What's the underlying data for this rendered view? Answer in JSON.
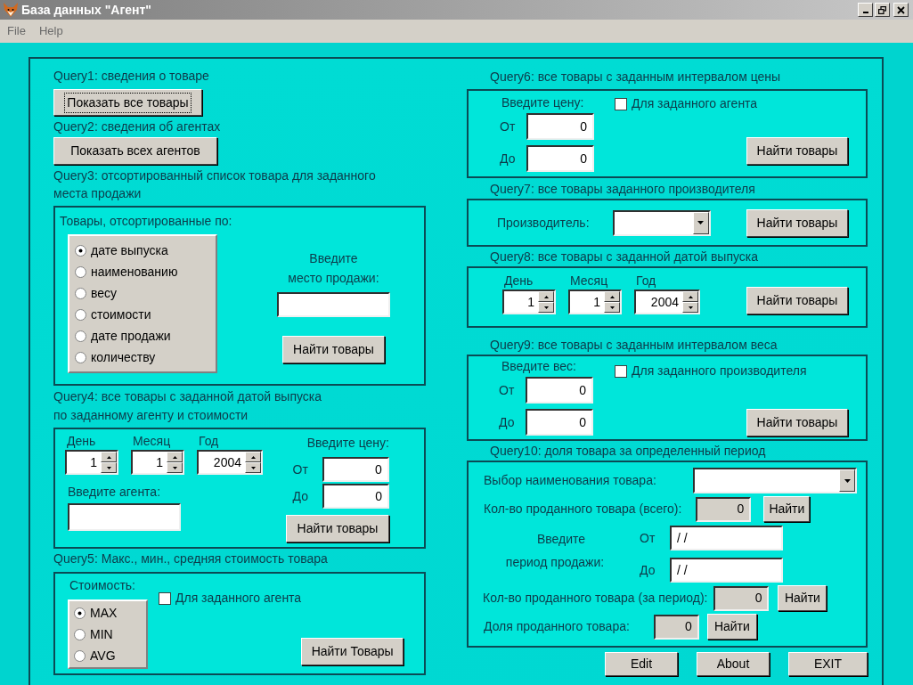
{
  "window": {
    "title": "База данных \"Агент\""
  },
  "menu": [
    {
      "label": "File"
    },
    {
      "label": "Help"
    }
  ],
  "query1": {
    "label": "Query1: сведения о товаре",
    "button": "Показать все товары",
    "focused": true
  },
  "query2": {
    "label": "Query2: сведения об агентах",
    "button": "Показать всех агентов",
    "focused": false
  },
  "query3": {
    "label": "Query3: отсортированный список  товара для заданного места продажи",
    "sort_heading": "Товары, отсортированные по:",
    "sort_options": [
      {
        "label": "дате выпуска",
        "selected": true
      },
      {
        "label": "наименованию",
        "selected": false
      },
      {
        "label": "весу",
        "selected": false
      },
      {
        "label": "стоимости",
        "selected": false
      },
      {
        "label": "дате продажи",
        "selected": false
      },
      {
        "label": "количеству",
        "selected": false
      }
    ],
    "place_label": [
      "Введите",
      "место продажи:"
    ],
    "button": "Найти товары"
  },
  "query4": {
    "label": [
      "Query4: все товары с заданной датой выпуска",
      "по заданному агенту и стоимости"
    ],
    "date": [
      {
        "label": "День",
        "value": "1"
      },
      {
        "label": "Месяц",
        "value": "1"
      },
      {
        "label": "Год",
        "value": "2004"
      }
    ],
    "price_label": "Введите цену:",
    "from": {
      "label": "От",
      "value": "0"
    },
    "to": {
      "label": "До",
      "value": "0"
    },
    "agent_label": "Введите агента:",
    "button": "Найти товары"
  },
  "query5": {
    "label": "Query5:  Макс., мин., средняя стоимость товара",
    "cost_label": "Стоимость:",
    "options": [
      {
        "label": "MAX",
        "selected": true
      },
      {
        "label": "MIN",
        "selected": false
      },
      {
        "label": "AVG",
        "selected": false
      }
    ],
    "checkbox": {
      "label": "Для заданного агента",
      "checked": false
    },
    "button": "Найти Товары"
  },
  "query6": {
    "label": "Query6: все товары с заданным интервалом цены",
    "price_label": "Введите цену:",
    "checkbox": {
      "label": "Для заданного агента",
      "checked": false
    },
    "from": {
      "label": "От",
      "value": "0"
    },
    "to": {
      "label": "До",
      "value": "0"
    },
    "button": "Найти товары"
  },
  "query7": {
    "label": "Query7: все товары заданного производителя",
    "maker_label": "Производитель:",
    "button": "Найти товары"
  },
  "query8": {
    "label": "Query8: все товары с заданной датой выпуска",
    "date": [
      {
        "label": "День",
        "value": "1"
      },
      {
        "label": "Месяц",
        "value": "1"
      },
      {
        "label": "Год",
        "value": "2004"
      }
    ],
    "button": "Найти товары"
  },
  "query9": {
    "label": "Query9: все товары с заданным интервалом веса",
    "weight_label": "Введите вес:",
    "checkbox": {
      "label": "Для заданного производителя",
      "checked": false
    },
    "from": {
      "label": "От",
      "value": "0"
    },
    "to": {
      "label": "До",
      "value": "0"
    },
    "button": "Найти товары"
  },
  "query10": {
    "label": "Query10: доля товара за определенный период",
    "product_label": "Выбор наименования товара:",
    "total": {
      "label": "Кол-во проданного товара (всего):",
      "value": "0",
      "button": "Найти"
    },
    "period_label": [
      "Введите",
      "период продажи:"
    ],
    "from": {
      "label": "От",
      "value": "/ /"
    },
    "to": {
      "label": "До",
      "value": "/ /"
    },
    "period_count": {
      "label": "Кол-во проданного товара (за период):",
      "value": "0",
      "button": "Найти"
    },
    "share": {
      "label": "Доля проданного товара:",
      "value": "0",
      "button": "Найти"
    }
  },
  "footer_buttons": [
    {
      "label": "Edit"
    },
    {
      "label": "About"
    },
    {
      "label": "EXIT"
    }
  ]
}
